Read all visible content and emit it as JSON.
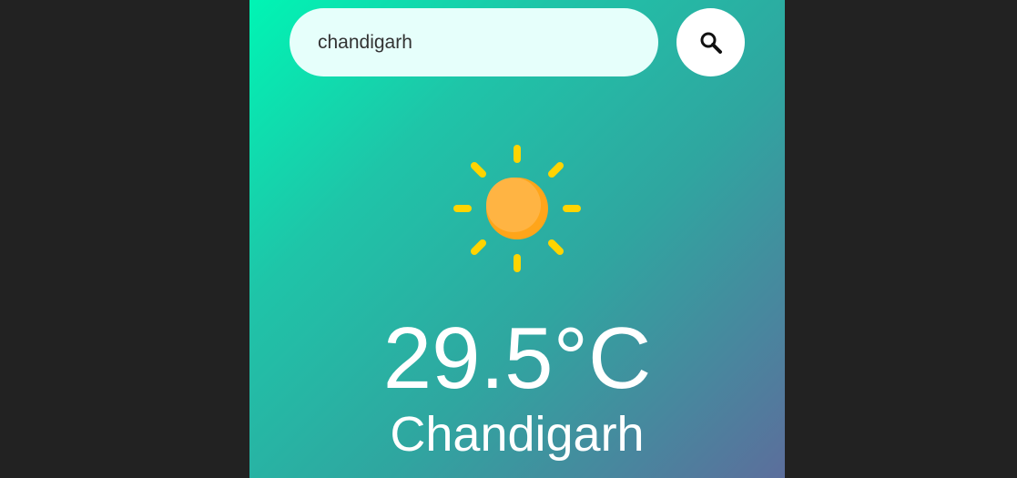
{
  "search": {
    "value": "chandigarh",
    "button_icon": "search-icon"
  },
  "weather": {
    "icon": "sun-icon",
    "temperature": "29.5°C",
    "city": "Chandigarh"
  },
  "colors": {
    "background": "#222222",
    "card_gradient_start": "#00f5b4",
    "card_gradient_end": "#5c6e9c",
    "input_bg": "#e6fffb",
    "sun_body": "#ffb02e",
    "sun_rays": "#ffd400",
    "text": "#ffffff"
  }
}
